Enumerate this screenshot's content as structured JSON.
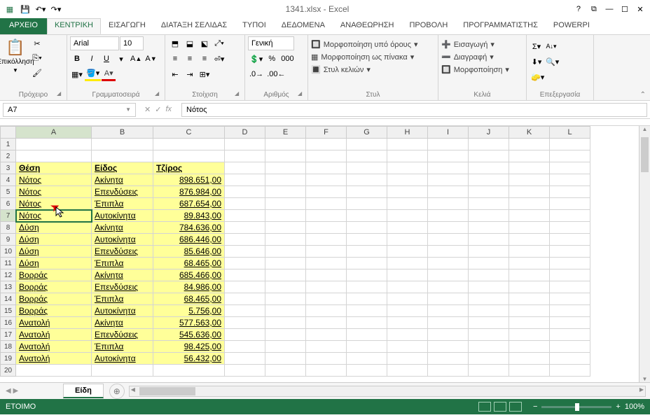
{
  "title": "1341.xlsx - Excel",
  "tabs": {
    "file": "ΑΡΧΕΙΟ",
    "home": "ΚΕΝΤΡΙΚΗ",
    "insert": "ΕΙΣΑΓΩΓΗ",
    "layout": "ΔΙΑΤΑΞΗ ΣΕΛΙΔΑΣ",
    "formulas": "ΤΥΠΟΙ",
    "data": "ΔΕΔΟΜΕΝΑ",
    "review": "ΑΝΑΘΕΩΡΗΣΗ",
    "view": "ΠΡΟΒΟΛΗ",
    "developer": "ΠΡΟΓΡΑΜΜΑΤΙΣΤΗΣ",
    "powerpi": "POWERPI"
  },
  "groups": {
    "clipboard": "Πρόχειρο",
    "font": "Γραμματοσειρά",
    "align": "Στοίχιση",
    "number": "Αριθμός",
    "styles": "Στυλ",
    "cells": "Κελιά",
    "editing": "Επεξεργασία"
  },
  "clipboard": {
    "paste": "Επικόλληση"
  },
  "font": {
    "name": "Arial",
    "size": "10",
    "bold": "B",
    "italic": "I",
    "underline": "U"
  },
  "number": {
    "format": "Γενική"
  },
  "styles": {
    "cond": "Μορφοποίηση υπό όρους",
    "table": "Μορφοποίηση ως πίνακα",
    "cell": "Στυλ κελιών"
  },
  "cellsmenu": {
    "insert": "Εισαγωγή",
    "delete": "Διαγραφή",
    "format": "Μορφοποίηση"
  },
  "namebox": "A7",
  "formula": "Νότος",
  "columns": [
    "A",
    "B",
    "C",
    "D",
    "E",
    "F",
    "G",
    "H",
    "I",
    "J",
    "K",
    "L"
  ],
  "header": {
    "a": "Θέση",
    "b": "Είδος",
    "c": "Τζίρος"
  },
  "rows": [
    {
      "r": "4",
      "a": "Νότος",
      "b": "Ακίνητα",
      "c": "898.651,00"
    },
    {
      "r": "5",
      "a": "Νότος",
      "b": "Επενδύσεις",
      "c": "876.984,00"
    },
    {
      "r": "6",
      "a": "Νότος",
      "b": "Έπιπλα",
      "c": "687.654,00"
    },
    {
      "r": "7",
      "a": "Νότος",
      "b": "Αυτοκίνητα",
      "c": "89.843,00"
    },
    {
      "r": "8",
      "a": "Δύση",
      "b": "Ακίνητα",
      "c": "784.636,00"
    },
    {
      "r": "9",
      "a": "Δύση",
      "b": "Αυτοκίνητα",
      "c": "686.446,00"
    },
    {
      "r": "10",
      "a": "Δύση",
      "b": "Επενδύσεις",
      "c": "85.646,00"
    },
    {
      "r": "11",
      "a": "Δύση",
      "b": "Έπιπλα",
      "c": "68.465,00"
    },
    {
      "r": "12",
      "a": "Βορράς",
      "b": "Ακίνητα",
      "c": "685.466,00"
    },
    {
      "r": "13",
      "a": "Βορράς",
      "b": "Επενδύσεις",
      "c": "84.986,00"
    },
    {
      "r": "14",
      "a": "Βορράς",
      "b": "Έπιπλα",
      "c": "68.465,00"
    },
    {
      "r": "15",
      "a": "Βορράς",
      "b": "Αυτοκίνητα",
      "c": "5.756,00"
    },
    {
      "r": "16",
      "a": "Ανατολή",
      "b": "Ακίνητα",
      "c": "577.563,00"
    },
    {
      "r": "17",
      "a": "Ανατολή",
      "b": "Επενδύσεις",
      "c": "545.636,00"
    },
    {
      "r": "18",
      "a": "Ανατολή",
      "b": "Έπιπλα",
      "c": "98.425,00"
    },
    {
      "r": "19",
      "a": "Ανατολή",
      "b": "Αυτοκίνητα",
      "c": "56.432,00"
    }
  ],
  "sheettab": "Είδη",
  "status": "ΕΤΟΙΜΟ",
  "zoom": "100%"
}
